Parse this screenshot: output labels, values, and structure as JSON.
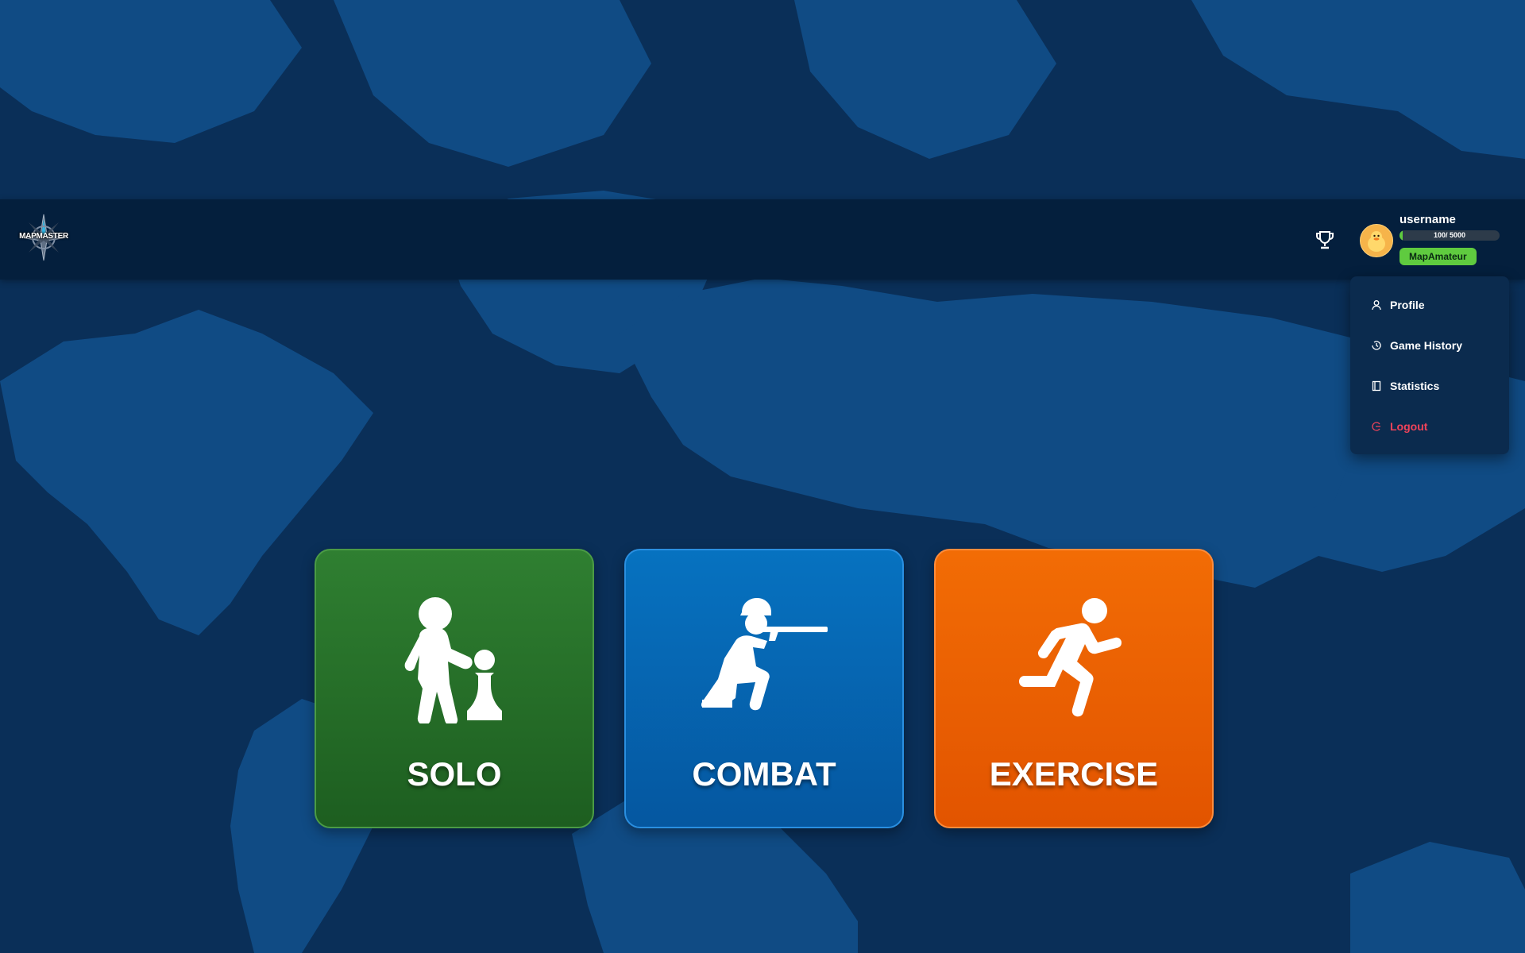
{
  "app": {
    "logo_text": "MAPMASTER"
  },
  "header": {
    "trophy_icon": "trophy-icon",
    "user": {
      "name": "username",
      "xp_text": "100/ 5000",
      "xp_fraction": 0.02,
      "rank": "MapAmateur",
      "avatar_icon": "duck-avatar"
    }
  },
  "user_menu": {
    "items": [
      {
        "label": "Profile",
        "icon": "user-icon"
      },
      {
        "label": "Game History",
        "icon": "history-icon"
      },
      {
        "label": "Statistics",
        "icon": "book-icon"
      },
      {
        "label": "Logout",
        "icon": "logout-icon",
        "color": "#f0435a"
      }
    ]
  },
  "modes": [
    {
      "label": "SOLO",
      "icon": "chess-teacher-icon",
      "color": "#2a7a2d"
    },
    {
      "label": "COMBAT",
      "icon": "soldier-rifle-icon",
      "color": "#0668b4"
    },
    {
      "label": "EXERCISE",
      "icon": "running-person-icon",
      "color": "#ee6203"
    }
  ],
  "colors": {
    "background": "#0c3563",
    "topbar": "#041f3d",
    "accent_green": "#5fcb3f",
    "logout_red": "#f0435a"
  }
}
